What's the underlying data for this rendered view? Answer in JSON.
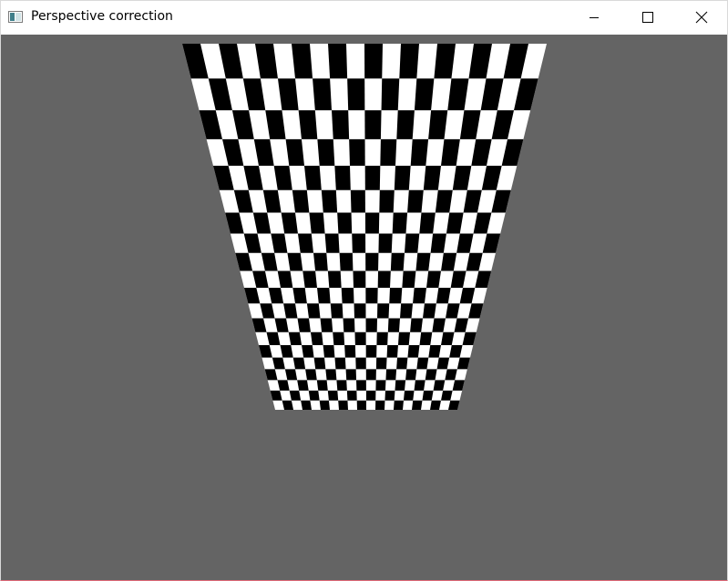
{
  "window": {
    "title": "Perspective correction",
    "icon": "app-window-icon",
    "controls": [
      "minimize-icon",
      "maximize-icon",
      "close-icon"
    ]
  },
  "canvas": {
    "background_color": "#646464",
    "checker_dark": "#000000",
    "checker_light": "#ffffff",
    "columns": 20,
    "rows": 20
  }
}
